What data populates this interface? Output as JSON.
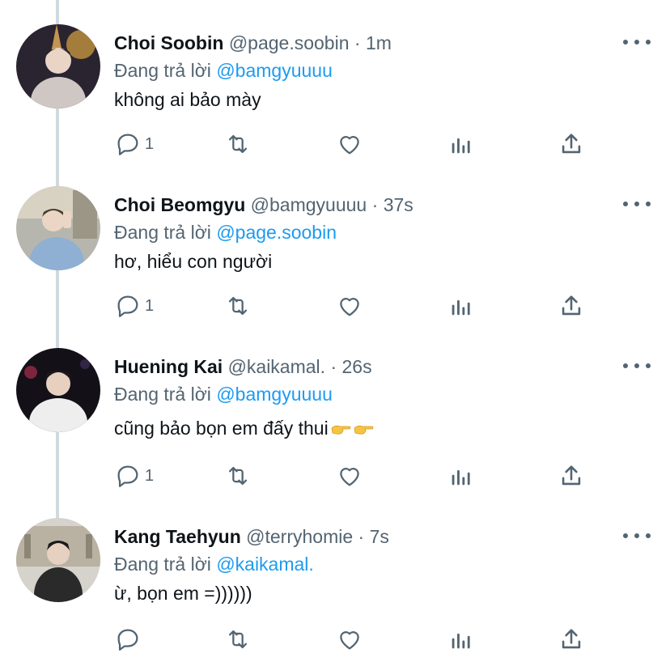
{
  "tweets": [
    {
      "name": "Choi Soobin",
      "handle": "@page.soobin",
      "separator": "·",
      "time": "1m",
      "reply_prefix": "Đang trả lời",
      "reply_to": "@bamgyuuuu",
      "text": "không ai bảo mày",
      "reply_count": "1"
    },
    {
      "name": "Choi Beomgyu",
      "handle": "@bamgyuuuu",
      "separator": "·",
      "time": "37s",
      "reply_prefix": "Đang trả lời",
      "reply_to": "@page.soobin",
      "text": "hơ, hiểu con người",
      "reply_count": "1"
    },
    {
      "name": "Huening Kai",
      "handle": "@kaikamal.",
      "separator": "·",
      "time": "26s",
      "reply_prefix": "Đang trả lời",
      "reply_to": "@bamgyuuuu",
      "text": "cũng bảo bọn em đấy thui",
      "text_emoji": [
        "pointing-right-emoji",
        "pointing-right-emoji"
      ],
      "reply_count": "1"
    },
    {
      "name": "Kang Taehyun",
      "handle": "@terryhomie",
      "separator": "·",
      "time": "7s",
      "reply_prefix": "Đang trả lời",
      "reply_to": "@kaikamal.",
      "text": "ừ, bọn em =))))))",
      "reply_count": ""
    }
  ],
  "icons": [
    "reply-icon",
    "retweet-icon",
    "like-icon",
    "analytics-icon",
    "share-icon",
    "more-icon"
  ],
  "colors": {
    "link": "#1d9bf0",
    "secondary": "#536471",
    "text": "#0f1419",
    "thread_line": "#cfd9de"
  }
}
